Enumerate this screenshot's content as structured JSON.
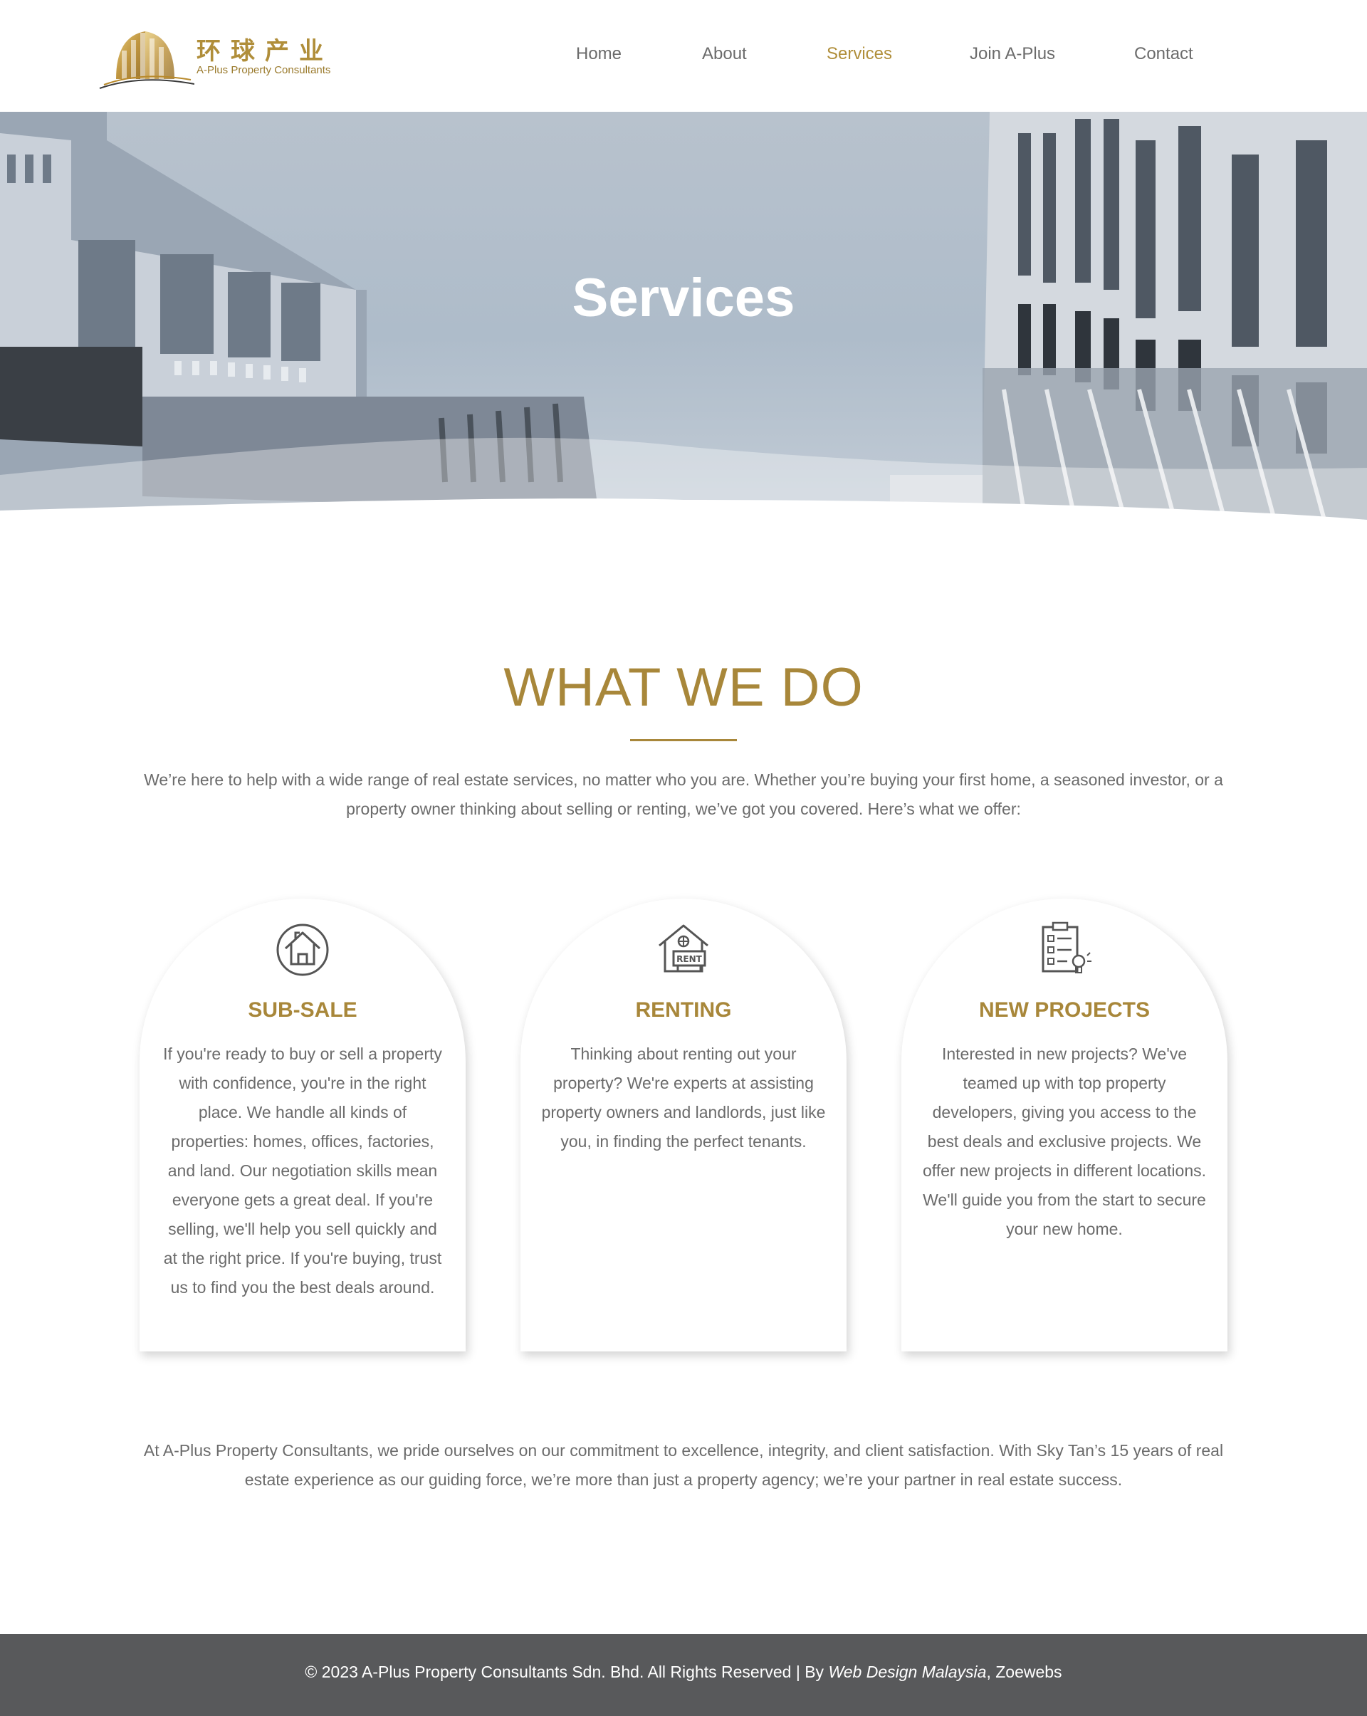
{
  "colors": {
    "accent": "#a8873a",
    "nav_active": "#b08e3a",
    "text": "#6b6b6b",
    "footer_bg": "#58595b"
  },
  "header": {
    "logo_cn": "环球产业",
    "logo_en": "A-Plus Property Consultants",
    "nav": [
      {
        "label": "Home"
      },
      {
        "label": "About"
      },
      {
        "label": "Services",
        "active": true
      },
      {
        "label": "Join A-Plus"
      },
      {
        "label": "Contact"
      }
    ]
  },
  "hero": {
    "title": "Services"
  },
  "main": {
    "section_title": "WHAT WE DO",
    "intro": "We’re here to help with a wide range of real estate services, no matter who you are. Whether you’re buying your first home, a seasoned investor, or a property owner thinking about selling or renting, we’ve got you covered. Here’s what we offer:",
    "cards": [
      {
        "icon": "house-icon",
        "title": "SUB-SALE",
        "text": "If you're ready to buy or sell a property with confidence, you're in the right place. We handle all kinds of properties: homes, offices, factories, and land. Our negotiation skills mean everyone gets a great deal. If you're selling, we'll help you sell quickly and at the right price. If you're buying, trust us to find you the best deals around."
      },
      {
        "icon": "rent-house-icon",
        "icon_label": "RENT",
        "title": "RENTING",
        "text": "Thinking about renting out your property? We're experts at assisting property owners and landlords, just like you, in finding the perfect tenants."
      },
      {
        "icon": "checklist-icon",
        "title": "NEW PROJECTS",
        "text": "Interested in new projects? We've teamed up with top property developers, giving you access to the best deals and exclusive projects. We offer new projects in different locations. We'll guide you from the start to secure your new home."
      }
    ],
    "closing": "At A-Plus Property Consultants, we pride ourselves on our commitment to excellence, integrity, and client satisfaction. With Sky Tan’s 15 years of real estate experience as our guiding force, we’re more than just a property agency; we’re your partner in real estate success."
  },
  "footer": {
    "copyright": "© 2023 A-Plus Property Consultants Sdn. Bhd. All Rights Reserved | By ",
    "credit_link": "Web Design Malaysia",
    "credit_suffix": ", Zoewebs"
  }
}
